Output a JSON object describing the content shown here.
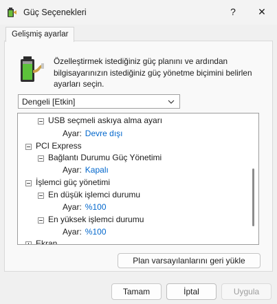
{
  "window": {
    "title": "Güç Seçenekleri",
    "help_label": "?",
    "close_label": "✕"
  },
  "tab": {
    "label": "Gelişmiş ayarlar"
  },
  "description": "Özelleştirmek istediğiniz güç planını ve ardından bilgisayarınızın istediğiniz güç yönetme biçimini belirlen ayarları seçin.",
  "plan_select": {
    "value": "Dengeli [Etkin]"
  },
  "tree": {
    "usb_setting": {
      "label": "USB seçmeli askıya alma ayarı",
      "setting_label": "Ayar:",
      "value": "Devre dışı"
    },
    "pci_express": {
      "label": "PCI Express"
    },
    "link_state": {
      "label": "Bağlantı Durumu Güç Yönetimi",
      "setting_label": "Ayar:",
      "value": "Kapalı"
    },
    "processor": {
      "label": "İşlemci güç yönetimi"
    },
    "min_state": {
      "label": "En düşük işlemci durumu",
      "setting_label": "Ayar:",
      "value": "%100"
    },
    "max_state": {
      "label": "En yüksek işlemci durumu",
      "setting_label": "Ayar:",
      "value": "%100"
    },
    "display": {
      "label": "Ekran"
    }
  },
  "buttons": {
    "restore": "Plan varsayılanlarını geri yükle",
    "ok": "Tamam",
    "cancel": "İptal",
    "apply": "Uygula"
  },
  "colors": {
    "link_value": "#0066cc",
    "background": "#f0f0f0"
  },
  "icons": {
    "app": "battery-plug-icon",
    "header": "battery-icon"
  }
}
